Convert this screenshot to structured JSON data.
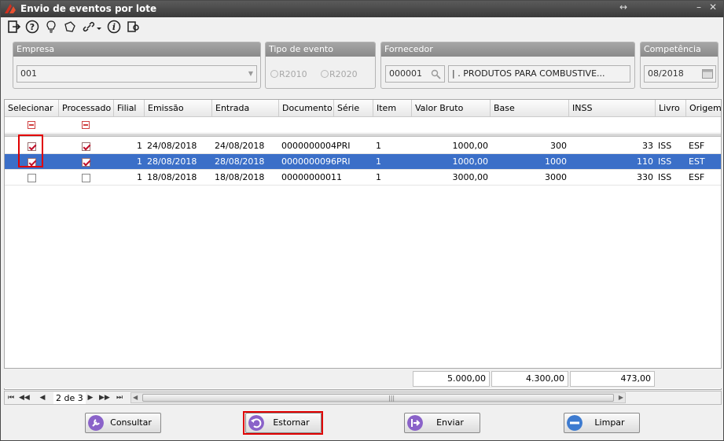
{
  "window": {
    "title": "Envio de eventos por lote",
    "restore_glyph": "↔",
    "minimize_glyph": "–",
    "close_glyph": "✕"
  },
  "toolbar": {
    "icons": [
      "exit-icon",
      "help-icon",
      "lightbulb-icon",
      "note-icon",
      "link-icon",
      "info-icon",
      "export-icon"
    ]
  },
  "empresa": {
    "label": "Empresa",
    "value": "001"
  },
  "tipo_evento": {
    "label": "Tipo de evento",
    "options": [
      "R2010",
      "R2020"
    ]
  },
  "fornecedor": {
    "label": "Fornecedor",
    "code": "000001",
    "name": "| . PRODUTOS PARA COMBUSTIVE..."
  },
  "competencia": {
    "label": "Competência",
    "value": "08/2018"
  },
  "grid": {
    "columns": [
      "Selecionar",
      "Processado",
      "Filial",
      "Emissão",
      "Entrada",
      "Documento",
      "Série",
      "Item",
      "Valor Bruto",
      "Base",
      "INSS",
      "Livro",
      "Origem"
    ],
    "rows": [
      {
        "selecionar": true,
        "processado": true,
        "filial": "1",
        "emissao": "24/08/2018",
        "entrada": "24/08/2018",
        "documento": "0000000004",
        "serie": "PRI",
        "item": "1",
        "valor_bruto": "1000,00",
        "base": "300",
        "inss": "33",
        "livro": "ISS",
        "origem": "ESF"
      },
      {
        "selecionar": true,
        "processado": true,
        "filial": "1",
        "emissao": "28/08/2018",
        "entrada": "28/08/2018",
        "documento": "0000000096",
        "serie": "PRI",
        "item": "1",
        "valor_bruto": "1000,00",
        "base": "1000",
        "inss": "110",
        "livro": "ISS",
        "origem": "EST"
      },
      {
        "selecionar": false,
        "processado": false,
        "filial": "1",
        "emissao": "18/08/2018",
        "entrada": "18/08/2018",
        "documento": "0000000001",
        "serie": "1",
        "item": "1",
        "valor_bruto": "3000,00",
        "base": "3000",
        "inss": "330",
        "livro": "ISS",
        "origem": "ESF"
      }
    ],
    "totals": {
      "valor_bruto": "5.000,00",
      "base": "4.300,00",
      "inss": "473,00"
    }
  },
  "pager": {
    "first": "⏮",
    "prev_page": "◀◀",
    "prev": "◀",
    "page_label": "2 de 3",
    "next": "▶",
    "next_page": "▶▶",
    "last": "⏭"
  },
  "buttons": {
    "consultar": "Consultar",
    "estornar": "Estornar",
    "enviar": "Enviar",
    "limpar": "Limpar"
  },
  "colors": {
    "selected_row": "#3b6fc8",
    "highlight": "#e00000"
  }
}
